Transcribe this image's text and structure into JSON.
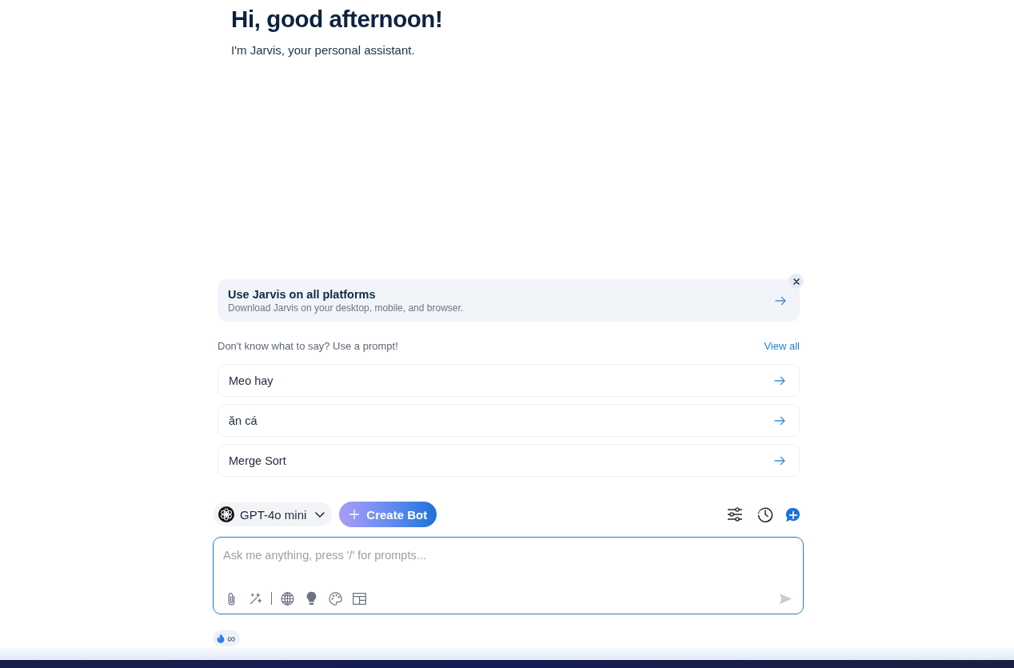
{
  "greeting": {
    "title": "Hi, good afternoon!",
    "subtitle": "I'm Jarvis, your personal assistant."
  },
  "banner": {
    "title": "Use Jarvis on all platforms",
    "description": "Download Jarvis on your desktop, mobile, and browser."
  },
  "prompts": {
    "hint": "Don't know what to say? Use a prompt!",
    "view_all": "View all",
    "items": [
      {
        "title": "Meo hay"
      },
      {
        "title": "ăn cá"
      },
      {
        "title": "Merge Sort"
      }
    ]
  },
  "toolbar": {
    "model": "GPT-4o mini",
    "create_bot": "Create Bot"
  },
  "composer": {
    "placeholder": "Ask me anything, press '/' for prompts...",
    "send_disabled": true
  },
  "tokens": {
    "count": "∞"
  }
}
